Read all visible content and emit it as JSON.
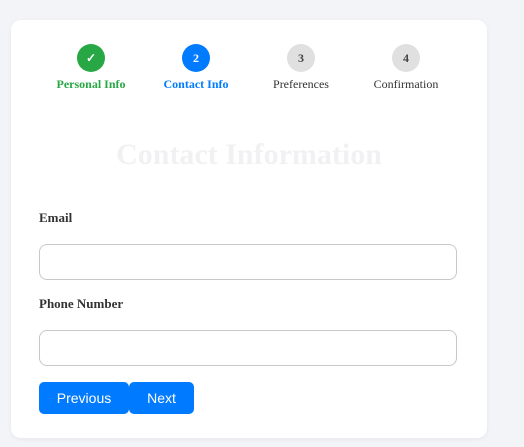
{
  "stepper": {
    "steps": [
      {
        "number": "✓",
        "label": "Personal Info",
        "state": "done"
      },
      {
        "number": "2",
        "label": "Contact Info",
        "state": "active"
      },
      {
        "number": "3",
        "label": "Preferences",
        "state": "todo"
      },
      {
        "number": "4",
        "label": "Confirmation",
        "state": "todo"
      }
    ]
  },
  "form": {
    "title": "Contact Information",
    "email": {
      "label": "Email",
      "value": "",
      "placeholder": ""
    },
    "phone": {
      "label": "Phone Number",
      "value": "",
      "placeholder": ""
    }
  },
  "buttons": {
    "previous": "Previous",
    "next": "Next"
  },
  "colors": {
    "accent": "#007bff",
    "success": "#28a745",
    "inactive": "#e0e0e0"
  }
}
